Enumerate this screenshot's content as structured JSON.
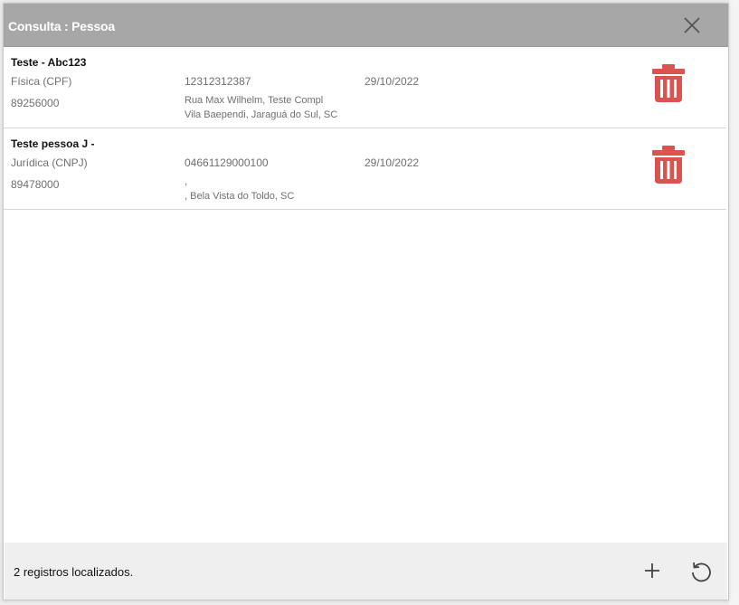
{
  "dialog": {
    "title": "Consulta : Pessoa"
  },
  "records": [
    {
      "name": "Teste - Abc123",
      "type": "Física (CPF)",
      "document": "12312312387",
      "date": "29/10/2022",
      "cep": "89256000",
      "address_line1": "Rua Max Wilhelm, Teste Compl",
      "address_line2": "Vila Baependi, Jaraguá do Sul, SC"
    },
    {
      "name": "Teste pessoa J -",
      "type": "Jurídica (CNPJ)",
      "document": "04661129000100",
      "date": "29/10/2022",
      "cep": "89478000",
      "address_line1": ",",
      "address_line2": ", Bela Vista do Toldo, SC"
    }
  ],
  "footer": {
    "status": "2 registros localizados."
  },
  "icons": {
    "close": "close-icon",
    "delete": "trash-icon",
    "add": "plus-icon",
    "refresh": "refresh-icon"
  },
  "colors": {
    "titlebar": "#a7a7a7",
    "delete": "#d9534f",
    "footer": "#efefef"
  }
}
